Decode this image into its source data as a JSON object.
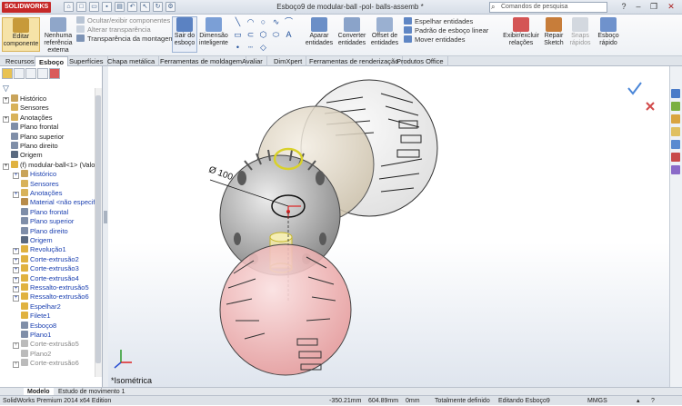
{
  "app": {
    "logo": "SOLIDWORKS",
    "title": "Esboço9 de modular-ball -pol- balls-assemb *"
  },
  "search": {
    "placeholder": "Comandos de pesquisa"
  },
  "ribbon": {
    "editar": "Editar componente",
    "nenhuma": "Nenhuma referência externa",
    "ocultar": "Ocultar/exibir componentes",
    "alterar": "Alterar transparência",
    "transp": "Transparência da montagem",
    "sair": "Sair do esboço",
    "dimensao": "Dimensão inteligente",
    "aparar": "Aparar entidades",
    "converter": "Converter entidades",
    "offset": "Offset de entidades",
    "espelhar": "Espelhar entidades",
    "padrao": "Padrão de esboço linear",
    "mover": "Mover entidades",
    "exibir": "Exibir/excluir relações",
    "repair": "Repair Sketch",
    "snaps": "Snaps rápidos",
    "esboco_rapido": "Esboço rápido"
  },
  "tabs": [
    "Recursos",
    "Esboço",
    "Superfícies",
    "Chapa metálica",
    "Ferramentas de moldagem",
    "Avaliar",
    "DimXpert",
    "Ferramentas de renderização",
    "Produtos Office"
  ],
  "tree": [
    {
      "label": "Histórico",
      "lvl": 0,
      "exp": true,
      "c": "#c9a45a"
    },
    {
      "label": "Sensores",
      "lvl": 0,
      "exp": false,
      "c": "#d8b25a"
    },
    {
      "label": "Anotações",
      "lvl": 0,
      "exp": true,
      "c": "#d8b25a"
    },
    {
      "label": "Plano frontal",
      "lvl": 0,
      "exp": false,
      "c": "#7f8ea8"
    },
    {
      "label": "Plano superior",
      "lvl": 0,
      "exp": false,
      "c": "#7f8ea8"
    },
    {
      "label": "Plano direito",
      "lvl": 0,
      "exp": false,
      "c": "#7f8ea8"
    },
    {
      "label": "Origem",
      "lvl": 0,
      "exp": false,
      "c": "#5a6a80"
    },
    {
      "label": "(f) modular-ball<1> (Valo",
      "lvl": 0,
      "exp": true,
      "c": "#e0b240"
    },
    {
      "label": "Histórico",
      "lvl": 1,
      "exp": true,
      "c": "#c9a45a"
    },
    {
      "label": "Sensores",
      "lvl": 1,
      "exp": false,
      "c": "#d8b25a"
    },
    {
      "label": "Anotações",
      "lvl": 1,
      "exp": true,
      "c": "#d8b25a"
    },
    {
      "label": "Material <não especif",
      "lvl": 1,
      "exp": false,
      "c": "#b88c4a"
    },
    {
      "label": "Plano frontal",
      "lvl": 1,
      "exp": false,
      "c": "#7f8ea8"
    },
    {
      "label": "Plano superior",
      "lvl": 1,
      "exp": false,
      "c": "#7f8ea8"
    },
    {
      "label": "Plano direito",
      "lvl": 1,
      "exp": false,
      "c": "#7f8ea8"
    },
    {
      "label": "Origem",
      "lvl": 1,
      "exp": false,
      "c": "#5a6a80"
    },
    {
      "label": "Revolução1",
      "lvl": 1,
      "exp": true,
      "c": "#e0b240"
    },
    {
      "label": "Corte-extrusão2",
      "lvl": 1,
      "exp": true,
      "c": "#e0b240"
    },
    {
      "label": "Corte-extrusão3",
      "lvl": 1,
      "exp": true,
      "c": "#e0b240"
    },
    {
      "label": "Corte-extrusão4",
      "lvl": 1,
      "exp": true,
      "c": "#e0b240"
    },
    {
      "label": "Ressalto-extrusão5",
      "lvl": 1,
      "exp": true,
      "c": "#e0b240"
    },
    {
      "label": "Ressalto-extrusão6",
      "lvl": 1,
      "exp": true,
      "c": "#e0b240"
    },
    {
      "label": "Espelhar2",
      "lvl": 1,
      "exp": false,
      "c": "#e0b240"
    },
    {
      "label": "Filete1",
      "lvl": 1,
      "exp": false,
      "c": "#e0b240"
    },
    {
      "label": "Esboço8",
      "lvl": 1,
      "exp": false,
      "c": "#7f8ea8"
    },
    {
      "label": "Plano1",
      "lvl": 1,
      "exp": false,
      "c": "#7f8ea8"
    },
    {
      "label": "Corte-extrusão5",
      "lvl": 1,
      "exp": true,
      "c": "#bbbbbb",
      "gray": true
    },
    {
      "label": "Plano2",
      "lvl": 1,
      "exp": false,
      "c": "#bbbbbb",
      "gray": true
    },
    {
      "label": "Corte-extrusão6",
      "lvl": 1,
      "exp": true,
      "c": "#bbbbbb",
      "gray": true
    }
  ],
  "viewport": {
    "dimension": "Ø 100",
    "view_name": "*Isométrica"
  },
  "bottom_tabs": [
    "Modelo",
    "Estudo de movimento 1"
  ],
  "status": {
    "edition": "SolidWorks Premium 2014 x64 Edition",
    "x": "-350.21mm",
    "y": "604.89mm",
    "z": "0mm",
    "defined": "Totalmente definido",
    "editing": "Editando Esboço9",
    "units": "MMGS"
  }
}
